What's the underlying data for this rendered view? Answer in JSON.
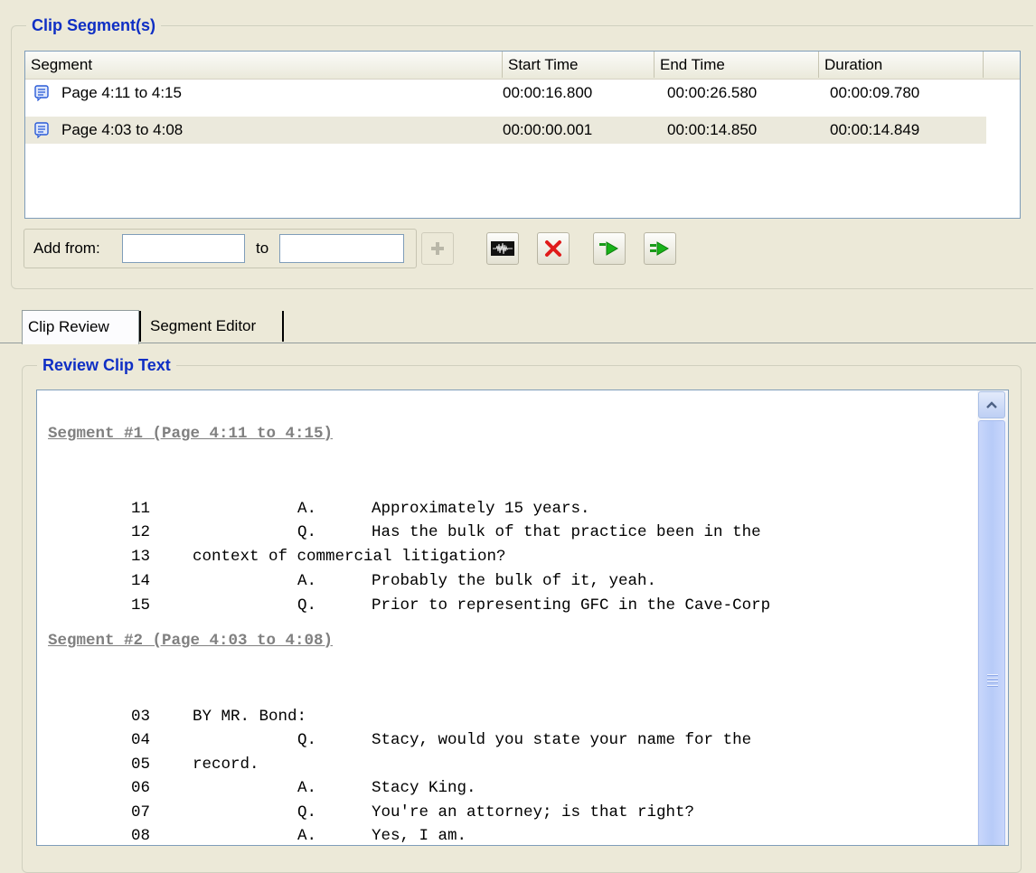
{
  "clip_segments": {
    "title": "Clip Segment(s)",
    "columns": [
      "Segment",
      "Start Time",
      "End Time",
      "Duration"
    ],
    "rows": [
      {
        "segment": "Page 4:11 to 4:15",
        "start": "00:00:16.800",
        "end": "00:00:26.580",
        "duration": "00:00:09.780",
        "selected": false
      },
      {
        "segment": "Page 4:03 to 4:08",
        "start": "00:00:00.001",
        "end": "00:00:14.850",
        "duration": "00:00:14.849",
        "selected": true
      }
    ]
  },
  "toolbar": {
    "add_from_label": "Add from:",
    "to_label": "to",
    "add_from_value": "",
    "to_value": "",
    "buttons": [
      "plus-icon",
      "waveform-icon",
      "delete-x-icon",
      "play-segment-icon",
      "play-all-icon"
    ]
  },
  "tabs": [
    {
      "label": "Clip Review",
      "active": true
    },
    {
      "label": "Segment Editor",
      "active": false
    }
  ],
  "review": {
    "title": "Review Clip Text",
    "segments": [
      {
        "heading": "Segment #1 (Page 4:11 to 4:15)",
        "lines": [
          {
            "num": "11",
            "speaker": "A.",
            "text": "Approximately 15 years."
          },
          {
            "num": "12",
            "speaker": "Q.",
            "text": "Has the bulk of that practice been in the"
          },
          {
            "num": "13",
            "speaker": "",
            "text": "context of commercial litigation?"
          },
          {
            "num": "14",
            "speaker": "A.",
            "text": "Probably the bulk of it, yeah."
          },
          {
            "num": "15",
            "speaker": "Q.",
            "text": "Prior to representing GFC in the Cave-Corp"
          }
        ]
      },
      {
        "heading": "Segment #2 (Page 4:03 to 4:08)",
        "lines": [
          {
            "num": "03",
            "speaker": "",
            "text": "BY MR. Bond:"
          },
          {
            "num": "04",
            "speaker": "Q.",
            "text": "Stacy, would you state your name for the"
          },
          {
            "num": "05",
            "speaker": "",
            "text": "record."
          },
          {
            "num": "06",
            "speaker": "A.",
            "text": "Stacy King."
          },
          {
            "num": "07",
            "speaker": "Q.",
            "text": "You're an attorney; is that right?"
          },
          {
            "num": "08",
            "speaker": "A.",
            "text": "Yes, I am."
          }
        ]
      }
    ]
  },
  "colors": {
    "background": "#ece9d8",
    "group_title": "#0f2fc4",
    "heading_gray": "#808080",
    "selected_row": "#ebe9dc"
  }
}
